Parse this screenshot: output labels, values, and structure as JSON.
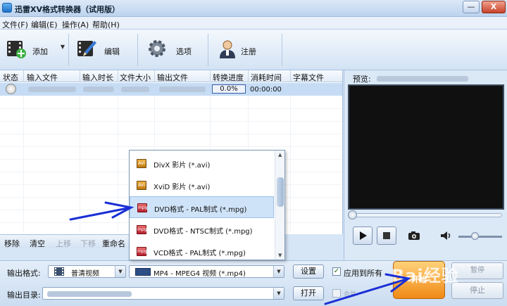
{
  "window": {
    "title": "迅雷XV格式转换器（试用版）",
    "min": "—",
    "max": "□",
    "close": "X"
  },
  "menu": [
    {
      "label": "文件(F)"
    },
    {
      "label": "编辑(E)"
    },
    {
      "label": "操作(A)"
    },
    {
      "label": "帮助(H)"
    }
  ],
  "toolbar": {
    "add": "添加",
    "edit": "编辑",
    "options": "选项",
    "register": "注册"
  },
  "table": {
    "headers": [
      "状态",
      "输入文件",
      "输入时长",
      "文件大小",
      "输出文件",
      "转换进度",
      "消耗时间",
      "字幕文件"
    ],
    "rows": [
      {
        "progress": "0.0%",
        "elapsed": "00:00:00"
      }
    ]
  },
  "list_actions": {
    "remove": "移除",
    "clear": "清空",
    "up": "上移",
    "down": "下移",
    "rename": "重命名"
  },
  "format_popup": {
    "items": [
      {
        "label": "DivX 影片 (*.avi)",
        "icon": "avi-file-icon"
      },
      {
        "label": "XviD 影片 (*.avi)",
        "icon": "avi-file-icon"
      },
      {
        "label": "DVD格式 - PAL制式 (*.mpg)",
        "icon": "mpg-file-icon",
        "selected": true
      },
      {
        "label": "DVD格式 - NTSC制式 (*.mpg)",
        "icon": "mpg-file-icon"
      },
      {
        "label": "VCD格式 - PAL制式 (*.mpg)",
        "icon": "mpg-file-icon"
      }
    ]
  },
  "bottom": {
    "output_format_label": "输出格式:",
    "category_value": "普清视频",
    "format_value": "MP4 - MPEG4 视频 (*.mp4)",
    "settings": "设置",
    "output_dir_label": "输出目录:",
    "open": "打开",
    "apply_all": "应用到所有",
    "merge": "合并",
    "start": "开始",
    "pause": "暂停",
    "stop": "停止"
  },
  "preview": {
    "label": "预览:"
  },
  "watermark": "Bai经验",
  "colors": {
    "accent": "#1c6fc6",
    "start_button": "#f08a16",
    "arrow": "#1a2fd6"
  }
}
